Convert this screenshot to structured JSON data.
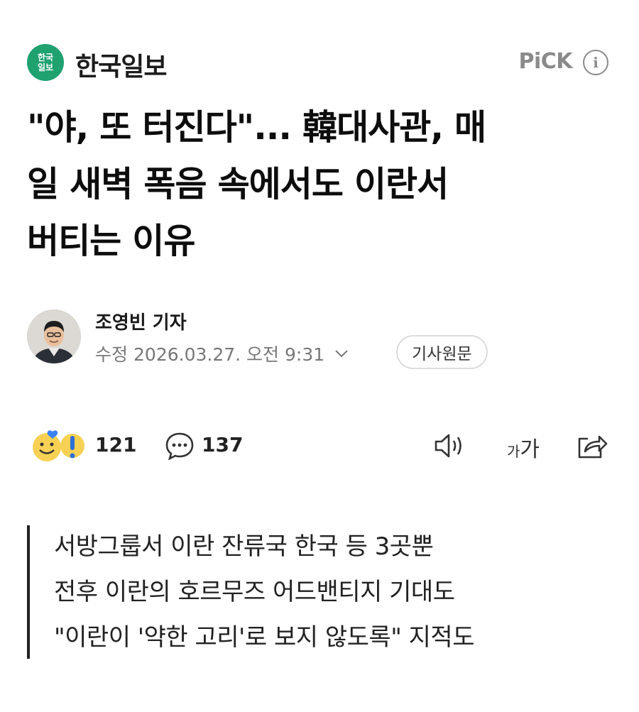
{
  "press": {
    "logo_line1": "한국",
    "logo_line2": "일보",
    "name": "한국일보",
    "pick_label": "PiCK",
    "info_icon": "info-circle-icon"
  },
  "article": {
    "headline_line1": "\"야, 또 터진다\"... 韓대사관, 매",
    "headline_line2": "일 새벽 폭음 속에서도 이란서",
    "headline_line3": "버티는 이유"
  },
  "author": {
    "name": "조영빈 기자",
    "date_prefix": "수정",
    "date": "2026.03.27. 오전 9:31",
    "original_button": "기사원문"
  },
  "actions": {
    "reaction_count": "121",
    "comment_count": "137",
    "font_size_small": "가",
    "font_size_large": "가"
  },
  "summary": [
    "서방그룹서 이란 잔류국 한국 등 3곳뿐",
    "전후 이란의 호르무즈 어드밴티지 기대도",
    "\"이란이 '약한 고리'로 보지 않도록\" 지적도"
  ],
  "colors": {
    "brand_green": "#1fa170",
    "pick_gray": "#8a8a8a"
  }
}
